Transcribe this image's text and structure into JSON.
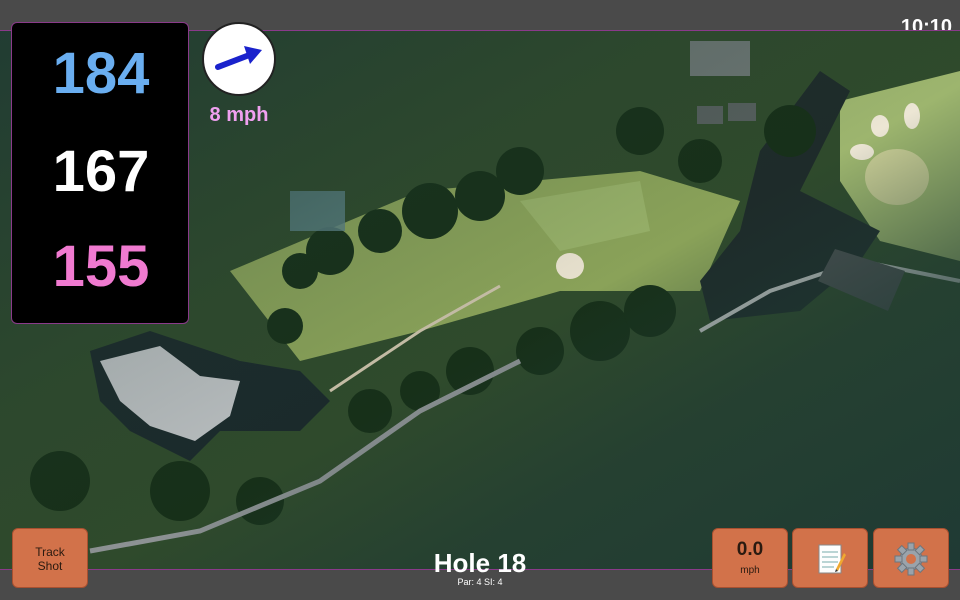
{
  "clock": "10:10",
  "distances": {
    "back": "184",
    "middle": "167",
    "front": "155",
    "colors": {
      "back": "#6aaef0",
      "middle": "#ffffff",
      "front": "#f07ad0"
    }
  },
  "wind": {
    "speed": "8 mph",
    "icon": "wind-direction-arrow-icon",
    "arrow_color": "#1a22cc"
  },
  "hole": {
    "title": "Hole 18",
    "info": "Par: 4   SI: 4"
  },
  "buttons": {
    "track_shot": "Track\nShot",
    "speed_value": "0.0",
    "speed_unit": "mph",
    "notes_icon": "notepad-icon",
    "settings_icon": "gear-icon",
    "color": "#d2724a"
  }
}
